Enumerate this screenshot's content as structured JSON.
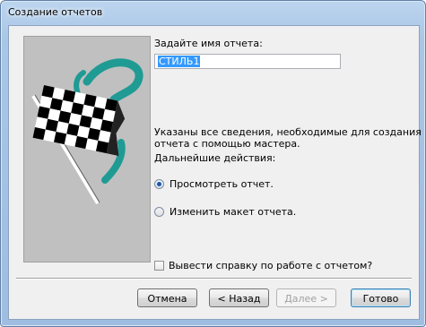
{
  "window": {
    "title": "Создание отчетов"
  },
  "form": {
    "name_prompt": "Задайте имя отчета:",
    "name_value": "СТИЛЬ1",
    "info_line1": "Указаны все сведения, необходимые для создания",
    "info_line2": "отчета с помощью мастера.",
    "next_actions": "Дальнейшие действия:",
    "options": [
      {
        "label": "Просмотреть отчет.",
        "selected": true
      },
      {
        "label": "Изменить макет отчета.",
        "selected": false
      }
    ],
    "help_checkbox": {
      "label": "Вывести справку по работе с отчетом?",
      "checked": false
    }
  },
  "buttons": {
    "cancel": "Отмена",
    "back": "< Назад",
    "next": "Далее >",
    "finish": "Готово"
  },
  "colors": {
    "flag_accent": "#1f9b94",
    "selection": "#3399ff"
  },
  "icons": {
    "illustration": "checkered-flag-icon"
  }
}
